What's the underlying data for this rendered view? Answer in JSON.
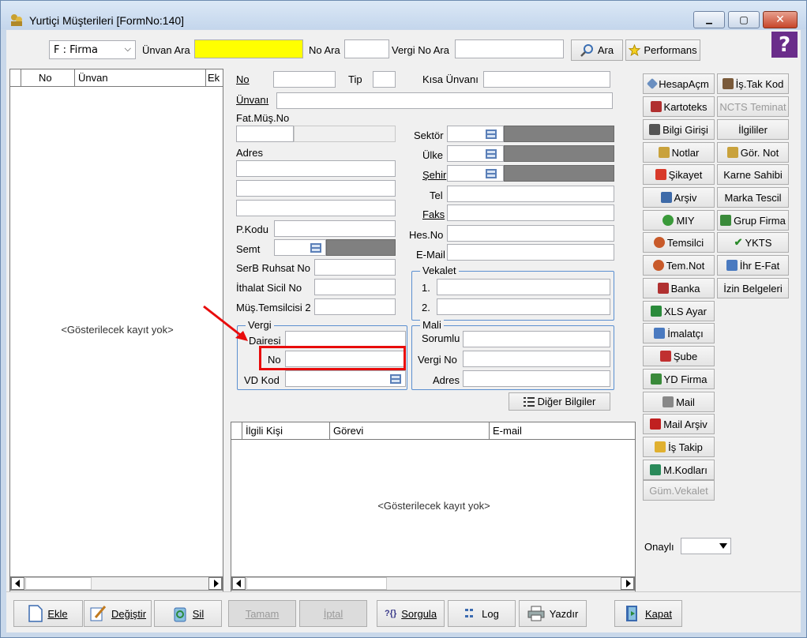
{
  "window": {
    "title": "Yurtiçi Müşterileri [FormNo:140]",
    "minimize_symbol": "▁",
    "maximize_symbol": "▢",
    "close_symbol": "✕"
  },
  "search": {
    "type_select": "F : Firma",
    "unvan_ara_label": "Ünvan Ara",
    "unvan_ara_value": "",
    "no_ara_label": "No Ara",
    "no_ara_value": "",
    "vergi_no_ara_label": "Vergi No Ara",
    "vergi_no_ara_value": "",
    "ara_button": "Ara",
    "performans_button": "Performans",
    "help_symbol": "?"
  },
  "list_grid": {
    "columns": [
      "No",
      "Ünvan",
      "Ek"
    ],
    "empty_text": "<Gösterilecek kayıt yok>"
  },
  "form": {
    "no_label": "No",
    "no_value": "",
    "tip_label": "Tip",
    "tip_value": "",
    "kisa_unvani_label": "Kısa Ünvanı",
    "kisa_unvani_value": "",
    "unvani_label": "Ünvanı",
    "unvani_value": "",
    "fat_mus_no_label": "Fat.Müş.No",
    "adres_label": "Adres",
    "pkodu_label": "P.Kodu",
    "semt_label": "Semt",
    "serb_ruhsat_label": "SerB Ruhsat No",
    "ithalat_sicil_label": "İthalat Sicil No",
    "mus_temsilcisi2_label": "Müş.Temsilcisi 2",
    "sektor_label": "Sektör",
    "ulke_label": "Ülke",
    "sehir_label": "Şehir",
    "tel_label": "Tel",
    "faks_label": "Faks",
    "hes_no_label": "Hes.No",
    "email_label": "E-Mail",
    "vekalet_group": "Vekalet",
    "vekalet_1": "1.",
    "vekalet_2": "2.",
    "vergi_group": "Vergi",
    "vergi_dairesi_label": "Dairesi",
    "vergi_no_label": "No",
    "vd_kod_label": "VD Kod",
    "mali_group": "Mali",
    "mali_sorumlu_label": "Sorumlu",
    "mali_vergi_no_label": "Vergi No",
    "mali_adres_label": "Adres",
    "diger_bilgiler_button": "Diğer Bilgiler"
  },
  "contacts_grid": {
    "columns": [
      "İlgili Kişi",
      "Görevi",
      "E-mail"
    ],
    "empty_text": "<Gösterilecek kayıt yok>"
  },
  "side_buttons": {
    "col1": [
      "HesapAçm",
      "Kartoteks",
      "Bilgi Girişi",
      "Notlar",
      "Şikayet",
      "Arşiv",
      "MIY",
      "Temsilci",
      "Tem.Not",
      "Banka",
      "XLS Ayar",
      "İmalatçı",
      "Şube",
      "YD Firma",
      "Mail",
      "Mail Arşiv",
      "İş Takip",
      "M.Kodları",
      "Güm.Vekalet"
    ],
    "col2": [
      "İş.Tak Kod",
      "NCTS Teminat",
      "İlgililer",
      "Gör. Not",
      "Karne Sahibi",
      "Marka Tescil",
      "Grup Firma",
      "YKTS",
      "İhr E-Fat",
      "İzin Belgeleri"
    ],
    "onayli_label": "Onaylı",
    "onayli_value": ""
  },
  "bottom_buttons": {
    "ekle": "Ekle",
    "degistir": "Değiştir",
    "sil": "Sil",
    "tamam": "Tamam",
    "iptal": "İptal",
    "sorgula": "Sorgula",
    "log": "Log",
    "yazdir": "Yazdır",
    "kapat": "Kapat"
  },
  "colors": {
    "highlight_input": "#ffff00",
    "annotation_red": "#e80c0c",
    "group_border": "#5b8fd0"
  }
}
